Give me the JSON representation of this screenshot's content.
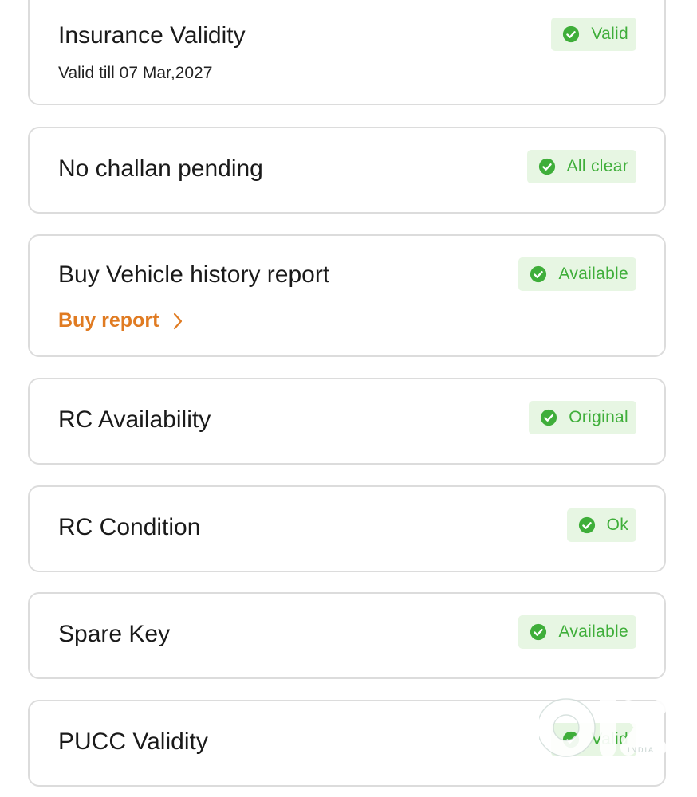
{
  "cards": [
    {
      "title": "Insurance Validity",
      "subtitle": "Valid till 07 Mar,2027",
      "status": "Valid"
    },
    {
      "title": "No challan pending",
      "status": "All clear"
    },
    {
      "title": "Buy Vehicle history report",
      "status": "Available",
      "link_label": "Buy report"
    },
    {
      "title": "RC Availability",
      "status": "Original"
    },
    {
      "title": "RC Condition",
      "status": "Ok"
    },
    {
      "title": "Spare Key",
      "status": "Available"
    },
    {
      "title": "PUCC Validity",
      "status": "Valid"
    }
  ],
  "icons": {
    "status": "check-circle-icon",
    "link": "chevron-right-icon",
    "watermark": "olx-logo"
  },
  "colors": {
    "badge_bg": "#e7f6e3",
    "badge_text": "#3fae3a",
    "check_fill": "#3fae3a",
    "link": "#e07b22",
    "card_border": "#dcdcdc"
  },
  "watermark": {
    "brand": "olx",
    "region": "INDIA"
  }
}
